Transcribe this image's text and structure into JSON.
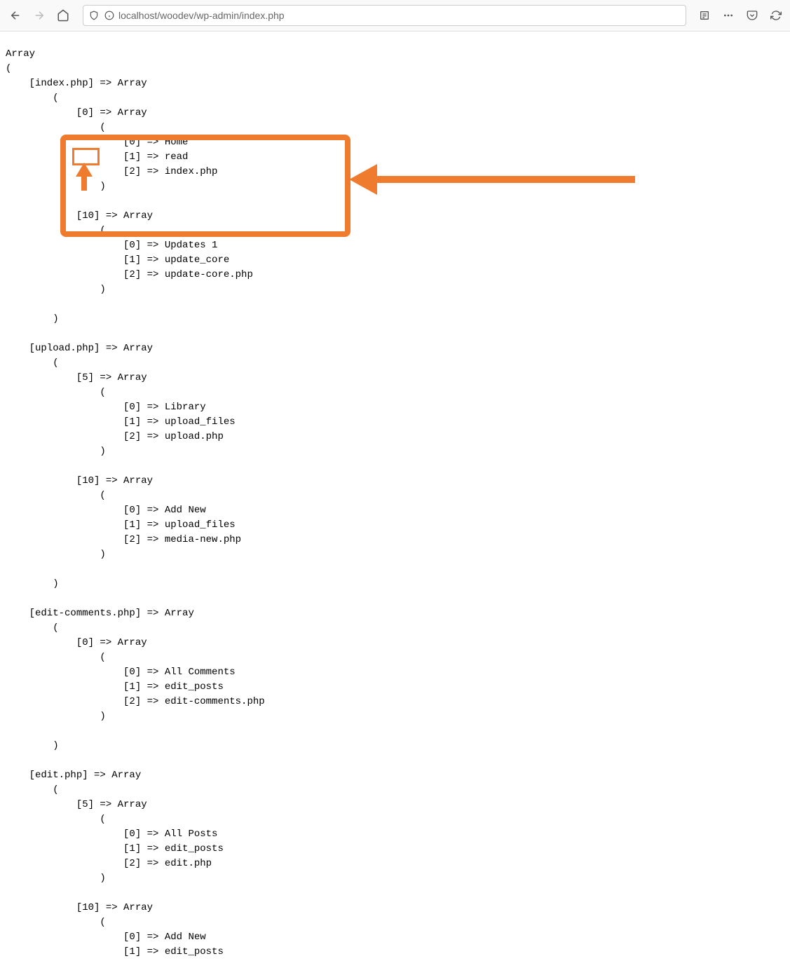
{
  "url": "localhost/woodev/wp-admin/index.php",
  "arrayDump": {
    "header": "Array",
    "open": "(",
    "close": ")",
    "entries": [
      {
        "key": "[index.php] => Array",
        "indent": "    ",
        "sub": [
          {
            "key": "[0] => Array",
            "indent": "            ",
            "lines": [
              "[0] => Home",
              "[1] => read",
              "[2] => index.php"
            ]
          },
          {
            "key": "[10] => Array",
            "indent": "            ",
            "lines": [
              "[0] => Updates 1",
              "[1] => update_core",
              "[2] => update-core.php"
            ]
          }
        ]
      },
      {
        "key": "[upload.php] => Array",
        "indent": "    ",
        "sub": [
          {
            "key": "[5] => Array",
            "indent": "            ",
            "lines": [
              "[0] => Library",
              "[1] => upload_files",
              "[2] => upload.php"
            ]
          },
          {
            "key": "[10] => Array",
            "indent": "            ",
            "lines": [
              "[0] => Add New",
              "[1] => upload_files",
              "[2] => media-new.php"
            ]
          }
        ]
      },
      {
        "key": "[edit-comments.php] => Array",
        "indent": "    ",
        "sub": [
          {
            "key": "[0] => Array",
            "indent": "            ",
            "lines": [
              "[0] => All Comments",
              "[1] => edit_posts",
              "[2] => edit-comments.php"
            ]
          }
        ]
      },
      {
        "key": "[edit.php] => Array",
        "indent": "    ",
        "sub": [
          {
            "key": "[5] => Array",
            "indent": "            ",
            "lines": [
              "[0] => All Posts",
              "[1] => edit_posts",
              "[2] => edit.php"
            ]
          },
          {
            "key": "[10] => Array",
            "indent": "            ",
            "lines": [
              "[0] => Add New",
              "[1] => edit_posts"
            ],
            "noClose": true
          }
        ],
        "noClose": true
      }
    ]
  }
}
